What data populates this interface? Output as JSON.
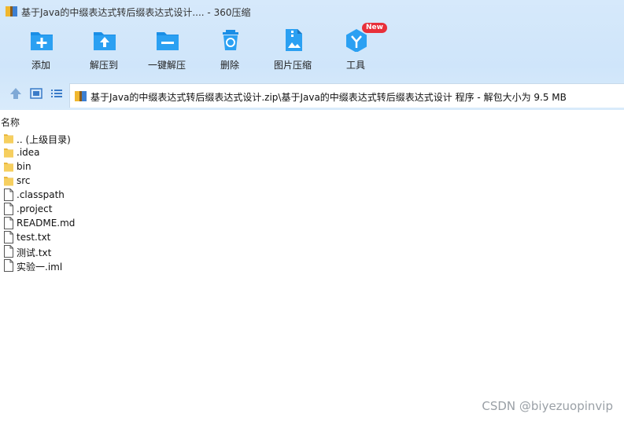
{
  "window": {
    "title": "基于Java的中缀表达式转后缀表达式设计.... - 360压缩"
  },
  "toolbar": {
    "add_label": "添加",
    "extract_label": "解压到",
    "oneclick_label": "一键解压",
    "delete_label": "删除",
    "image_label": "图片压缩",
    "tools_label": "工具",
    "tools_badge": "New"
  },
  "nav": {
    "path": "基于Java的中缀表达式转后缀表达式设计.zip\\基于Java的中缀表达式转后缀表达式设计 程序 - 解包大小为 9.5 MB"
  },
  "list": {
    "header_name": "名称",
    "items": [
      {
        "name": ".. (上级目录)",
        "type": "folder"
      },
      {
        "name": ".idea",
        "type": "folder"
      },
      {
        "name": "bin",
        "type": "folder"
      },
      {
        "name": "src",
        "type": "folder"
      },
      {
        "name": ".classpath",
        "type": "file"
      },
      {
        "name": ".project",
        "type": "file"
      },
      {
        "name": "README.md",
        "type": "file"
      },
      {
        "name": "test.txt",
        "type": "file"
      },
      {
        "name": "测试.txt",
        "type": "file"
      },
      {
        "name": "实验一.iml",
        "type": "file"
      }
    ]
  },
  "watermark": "CSDN @biyezuopinvip",
  "colors": {
    "toolbar_bg": "#d6e9fb",
    "icon_blue": "#1a8ee6",
    "badge_red": "#e8303a",
    "folder_yellow": "#f6cf5f"
  }
}
